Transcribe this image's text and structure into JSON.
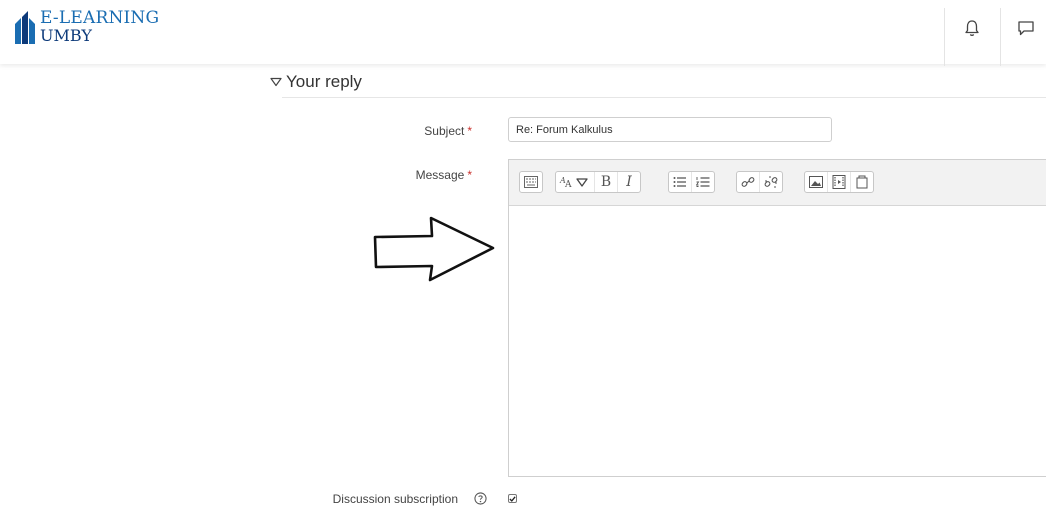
{
  "header": {
    "logo_line1": "E-LEARNING",
    "logo_line2": "UMBY",
    "icons": [
      "bell-icon",
      "message-icon"
    ]
  },
  "section": {
    "title": "Your reply"
  },
  "form": {
    "subject_label": "Subject",
    "subject_value": "Re: Forum Kalkulus",
    "message_label": "Message",
    "required_marker": "*",
    "subscription_label": "Discussion subscription",
    "subscription_checked": true
  },
  "editor": {
    "toolbar_groups": [
      [
        "show-more-buttons-icon"
      ],
      [
        "font-style-icon",
        "bold-icon",
        "italic-icon"
      ],
      [
        "unordered-list-icon",
        "ordered-list-icon"
      ],
      [
        "link-icon",
        "unlink-icon"
      ],
      [
        "insert-image-icon",
        "insert-media-icon",
        "manage-files-icon"
      ]
    ],
    "bold_glyph": "B",
    "italic_glyph": "I",
    "content": ""
  },
  "colors": {
    "accent": "#1a6db2",
    "logo_dark": "#0d3a7a",
    "required": "#c9302c"
  }
}
